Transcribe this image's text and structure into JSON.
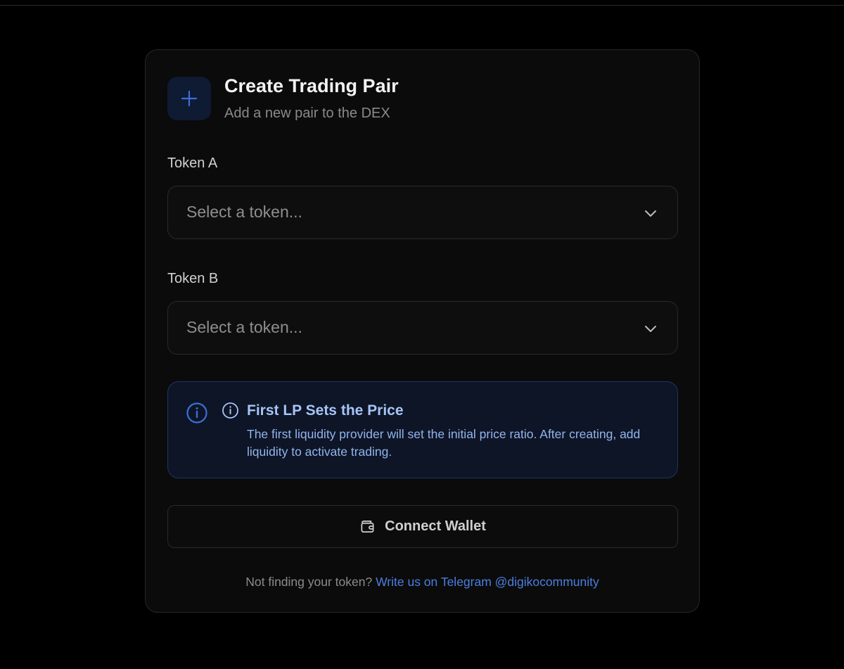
{
  "header": {
    "title": "Create Trading Pair",
    "subtitle": "Add a new pair to the DEX",
    "icon": "plus-icon"
  },
  "form": {
    "token_a": {
      "label": "Token A",
      "placeholder": "Select a token..."
    },
    "token_b": {
      "label": "Token B",
      "placeholder": "Select a token..."
    }
  },
  "notice": {
    "title": "First LP Sets the Price",
    "body": "The first liquidity provider will set the initial price ratio. After creating, add liquidity to activate trading.",
    "icon": "info-icon"
  },
  "actions": {
    "connect_label": "Connect Wallet",
    "connect_icon": "wallet-icon"
  },
  "footer": {
    "prompt": "Not finding your token?",
    "link_text": "Write us on Telegram @digikocommunity"
  },
  "colors": {
    "background": "#000000",
    "card": "#0b0b0b",
    "accent": "#3b6fd8",
    "notice_bg": "#0d1526",
    "link": "#4a7fe0"
  }
}
